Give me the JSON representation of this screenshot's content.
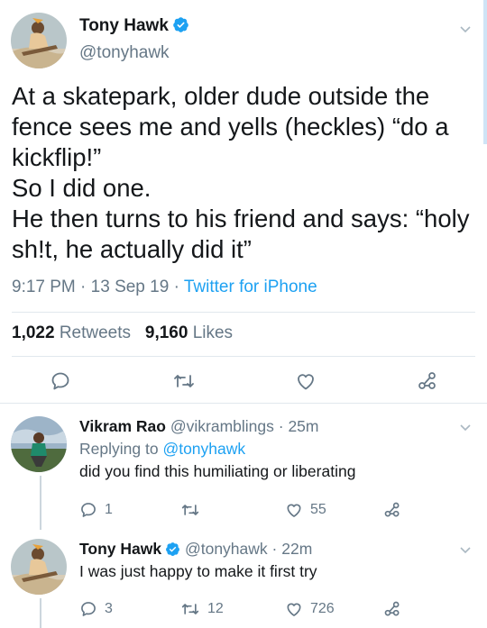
{
  "main_tweet": {
    "author_name": "Tony Hawk",
    "author_handle": "@tonyhawk",
    "text": "At a skatepark, older dude outside the fence sees me and yells (heckles) “do a kickflip!”\nSo I did one.\nHe then turns to his friend and says: “holy sh!t, he actually did it”",
    "time": "9:17 PM",
    "date": "13 Sep 19",
    "separator": "·",
    "source": "Twitter for iPhone",
    "retweets_count": "1,022",
    "retweets_label": "Retweets",
    "likes_count": "9,160",
    "likes_label": "Likes"
  },
  "replies": [
    {
      "author_name": "Vikram Rao",
      "author_handle": "@vikramblings",
      "time_ago": "· 25m",
      "replying_prefix": "Replying to",
      "replying_to": "@tonyhawk",
      "text": "did you find this humiliating or liberating",
      "reply_count": "1",
      "retweet_count": "",
      "like_count": "55"
    },
    {
      "author_name": "Tony Hawk",
      "author_handle": "@tonyhawk",
      "time_ago": "· 22m",
      "text": "I was just happy to make it first try",
      "reply_count": "3",
      "retweet_count": "12",
      "like_count": "726"
    }
  ],
  "icons": {
    "reply": "reply-icon",
    "retweet": "retweet-icon",
    "like": "heart-icon",
    "share": "share-icon",
    "more": "chevron-down-icon",
    "verified": "verified-badge-icon"
  },
  "colors": {
    "accent": "#1da1f2",
    "muted": "#657786",
    "text": "#14171a",
    "divider": "#e1e8ed"
  }
}
